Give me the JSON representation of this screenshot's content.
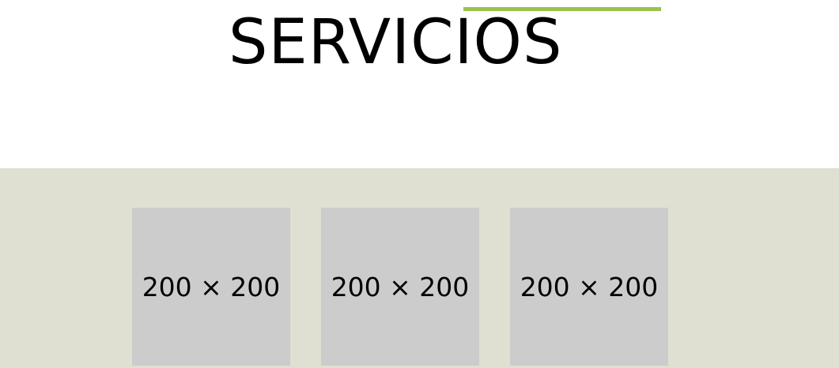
{
  "colors": {
    "accent": "#9bc24a",
    "band": "#dfe0d1",
    "placeholder": "#cccccc"
  },
  "section": {
    "title": "SERVICIOS"
  },
  "services": [
    {
      "label": "200 × 200"
    },
    {
      "label": "200 × 200"
    },
    {
      "label": "200 × 200"
    }
  ]
}
